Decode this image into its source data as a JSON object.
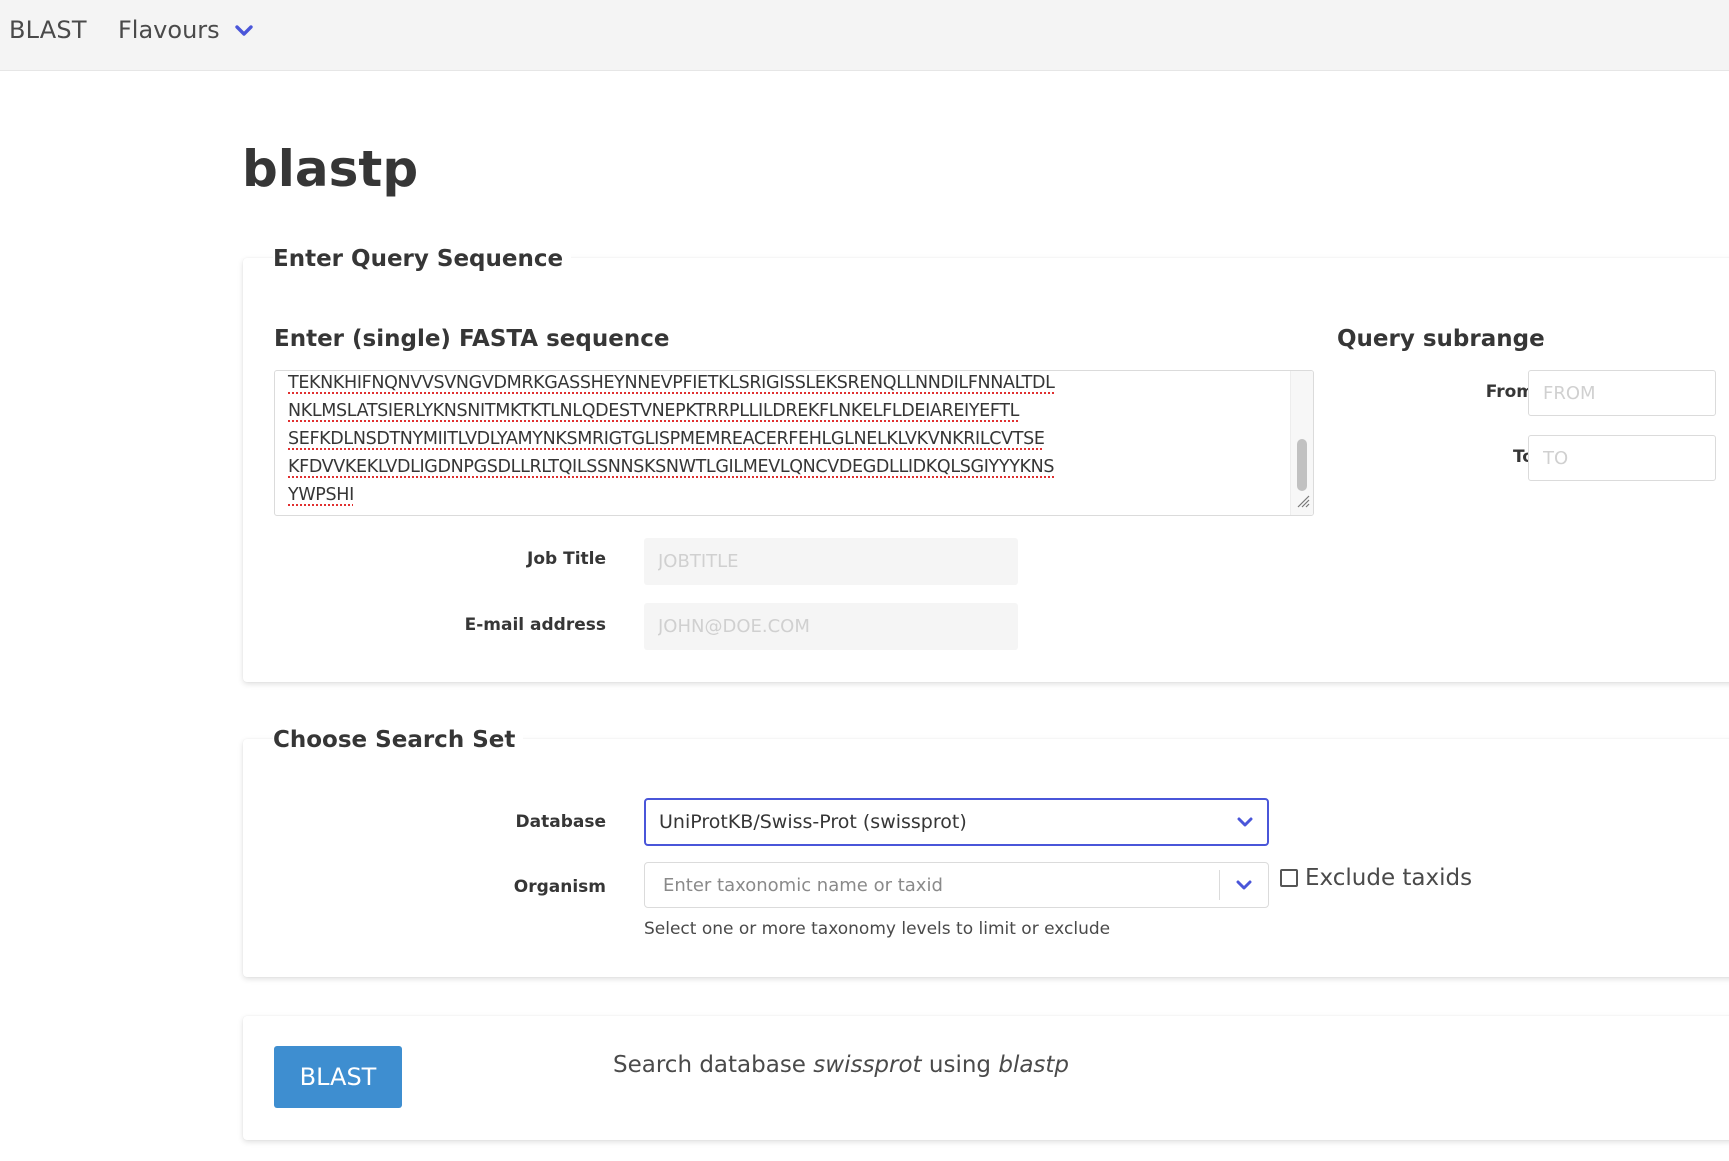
{
  "nav": {
    "brand": "BLAST",
    "flavours_label": "Flavours",
    "accent_color": "#4a56d9"
  },
  "page": {
    "title": "blastp"
  },
  "query": {
    "legend": "Enter Query Sequence",
    "fasta_label": "Enter (single) FASTA sequence",
    "sequence_lines": [
      "TEKNKHIFNQNVVSVNGVDMRKGASSHEYNNEVPFIETKLSRIGISSLEKSRENQLLNNDILFNNALTDL",
      "NKLMSLATSIERLYKNSNITMKTKTLNLQDESTVNEPKTRRPLLILDREKFLNKELFLDEIAREIYEFTL",
      "SEFKDLNSDTNYMIITLVDLYAMYNKSMRIGTGLISPMEMREACERFEHLGLNELKLVKVNKRILCVTSE",
      "KFDVVKEKLVDLIGDNPGSDLLRLTQILSSNNSKSNWTLGILMEVLQNCVDEGDLLIDKQLSGIYYYKNS",
      "YWPSHI"
    ],
    "subrange_label": "Query subrange",
    "from_label": "From",
    "from_placeholder": "FROM",
    "to_label": "To",
    "to_placeholder": "TO",
    "job_title_label": "Job Title",
    "job_title_placeholder": "JOBTITLE",
    "email_label": "E-mail address",
    "email_placeholder": "JOHN@DOE.COM"
  },
  "search_set": {
    "legend": "Choose Search Set",
    "database_label": "Database",
    "database_value": "UniProtKB/Swiss-Prot (swissprot)",
    "organism_label": "Organism",
    "organism_placeholder": "Enter taxonomic name or taxid",
    "exclude_label": "Exclude taxids",
    "exclude_checked": false,
    "help_text": "Select one or more taxonomy levels to limit or exclude"
  },
  "submit": {
    "button_label": "BLAST",
    "summary_prefix": "Search database",
    "summary_db": "swissprot",
    "summary_middle": "using",
    "summary_program": "blastp",
    "button_color": "#3e8ed0"
  }
}
